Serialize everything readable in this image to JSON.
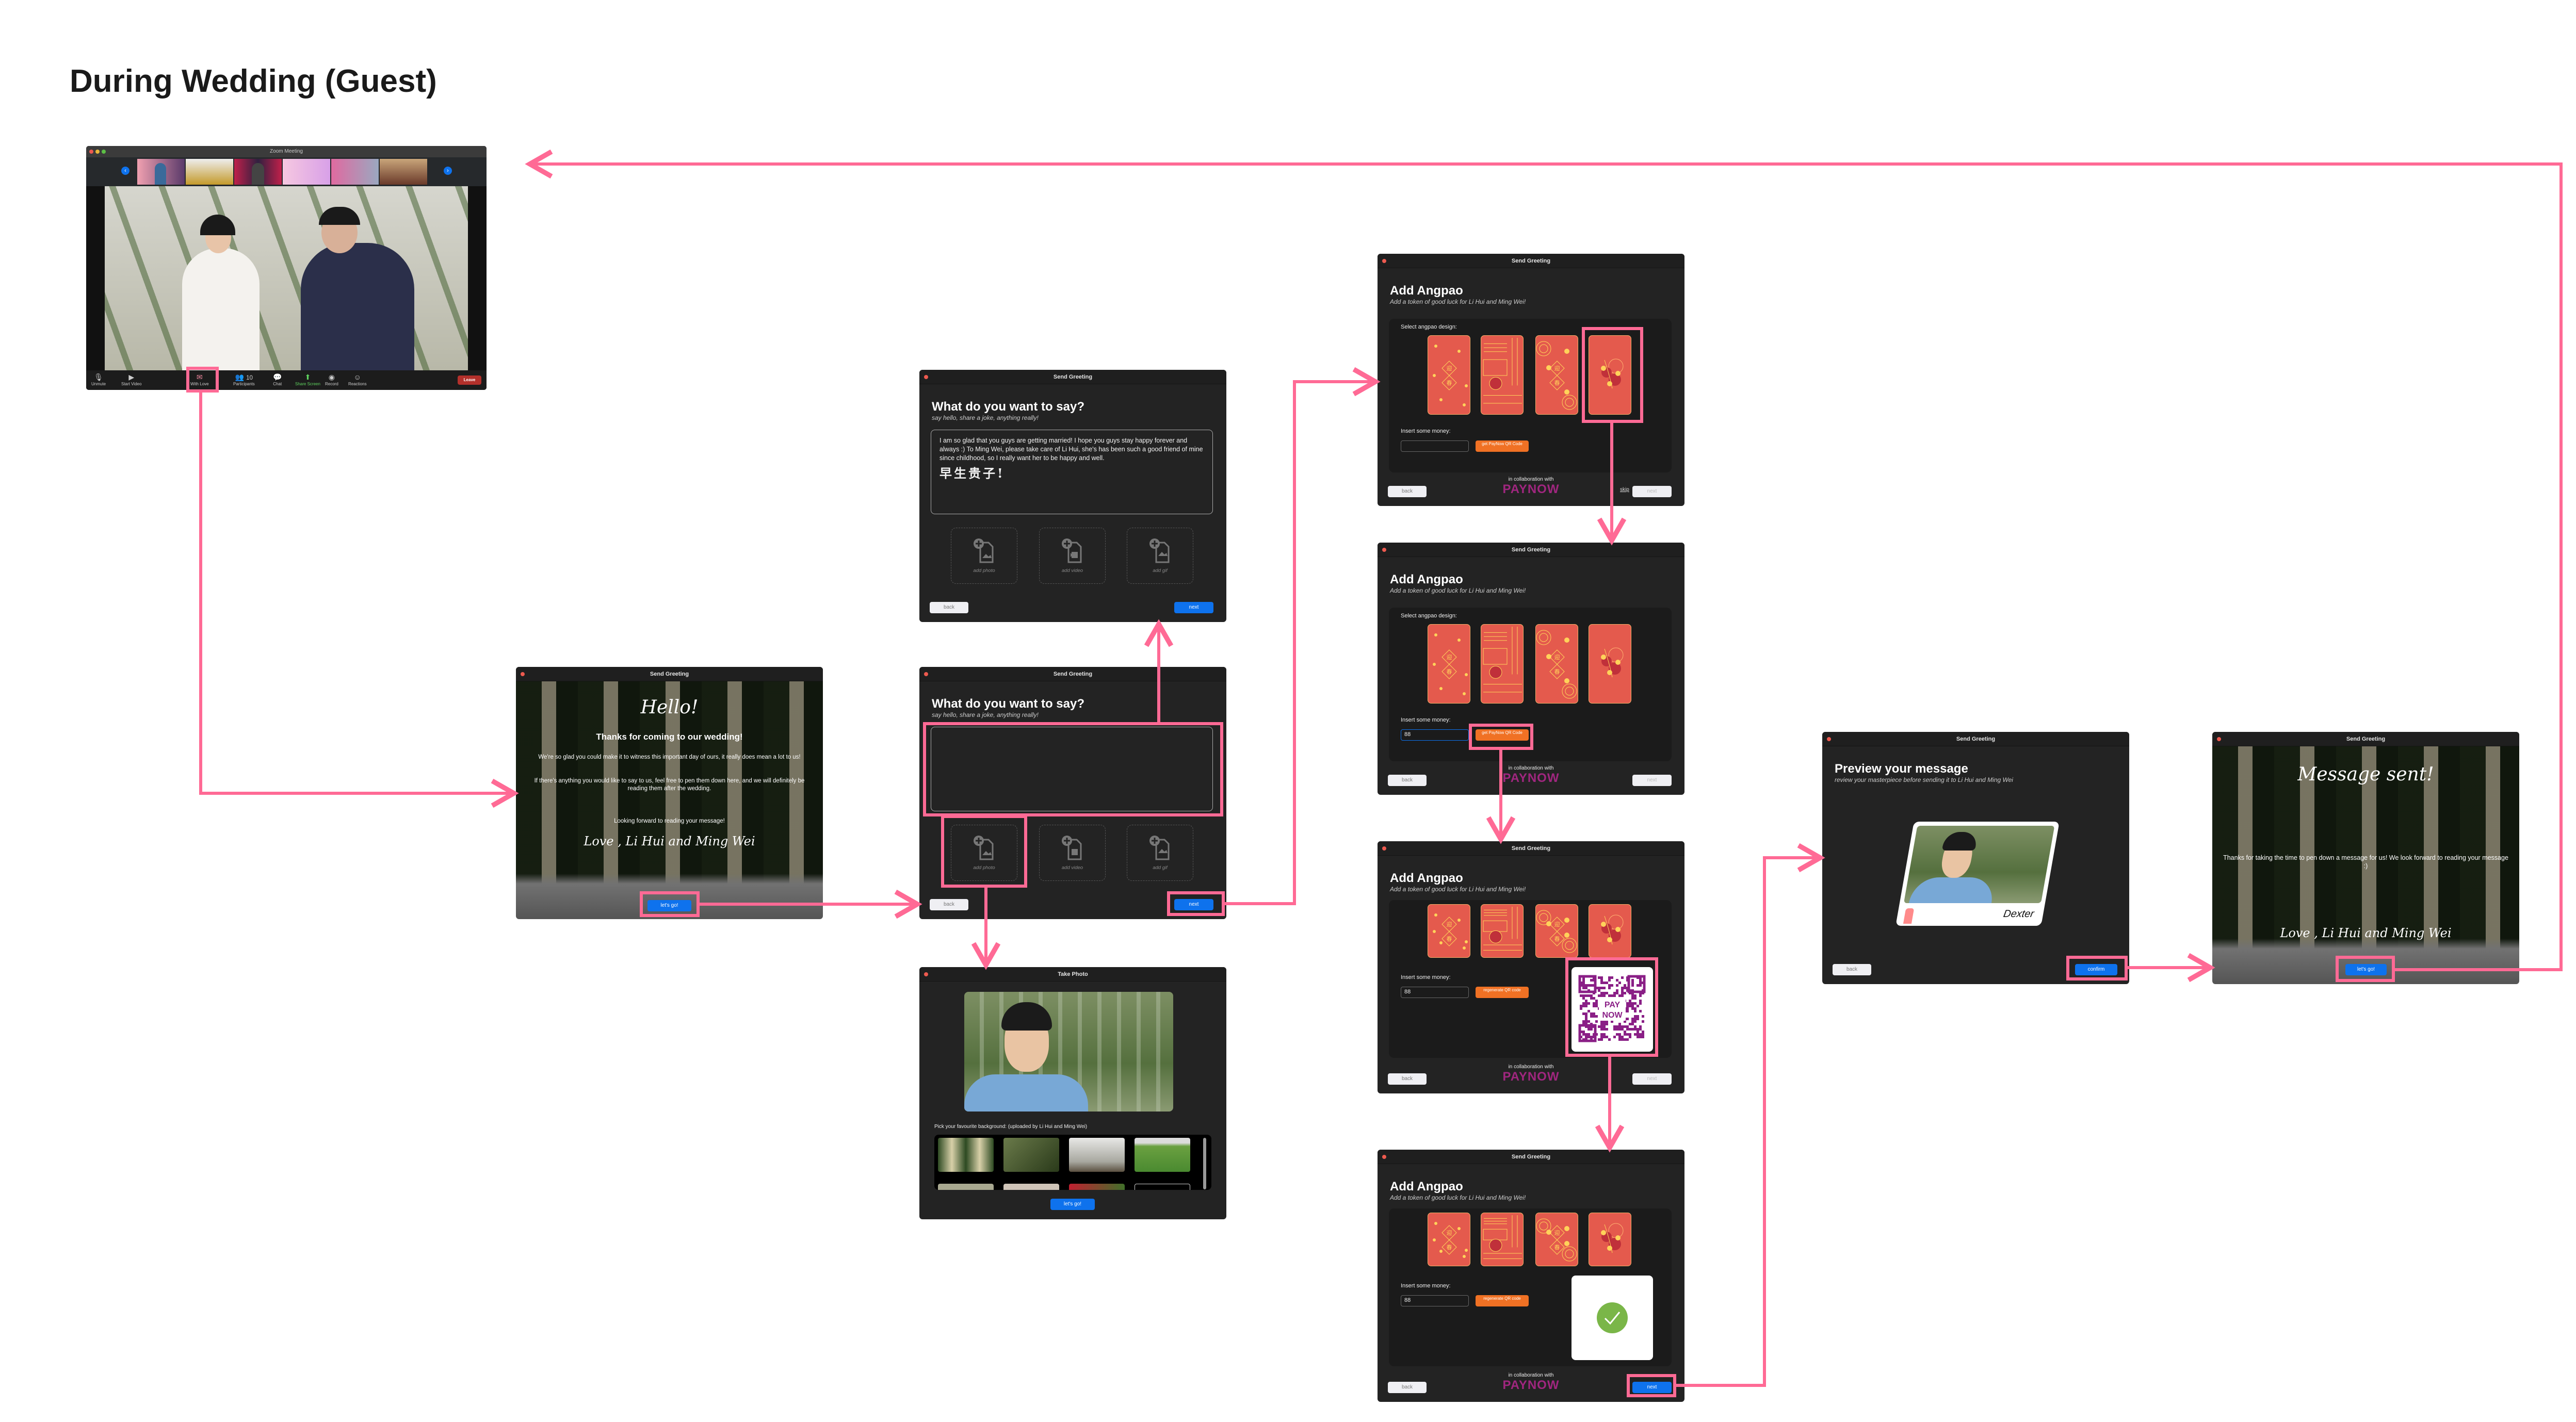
{
  "page_title": "During Wedding (Guest)",
  "colors": {
    "accent_pink": "#ff6a95",
    "button_blue": "#0e72ed",
    "paynow_purple": "#a0267f",
    "qr_orange": "#f07124",
    "angpao_red": "#e45a4d",
    "success_green": "#7ab648"
  },
  "zoom_meeting": {
    "title": "Zoom Meeting",
    "toolbar": [
      {
        "label": "Unmute",
        "icon": "mic-muted-icon"
      },
      {
        "label": "Start Video",
        "icon": "video-off-icon"
      },
      {
        "label": "With Love",
        "icon": "envelope-heart-icon"
      },
      {
        "label": "Participants",
        "icon": "participants-icon",
        "count": "10"
      },
      {
        "label": "Chat",
        "icon": "chat-icon"
      },
      {
        "label": "Share Screen",
        "icon": "share-screen-icon"
      },
      {
        "label": "Record",
        "icon": "record-icon"
      },
      {
        "label": "Reactions",
        "icon": "reactions-icon"
      }
    ],
    "leave": "Leave"
  },
  "common": {
    "window_title": "Send Greeting",
    "back": "back",
    "next": "next",
    "lets_go": "let's go!",
    "skip": "skip",
    "collab": "in collaboration with",
    "paynow": "PAYNOW"
  },
  "hello_screen": {
    "greeting": "Hello!",
    "headline": "Thanks for coming to our wedding!",
    "para1": "We're so glad you could make it to witness this important day of ours, it really does mean a lot to us!",
    "para2": "If there's anything you would like to say to us, feel free to pen them down here, and we will definitely be reading them after the wedding.",
    "para3": "Looking forward to reading your message!",
    "signoff": "Love , Li Hui and Ming Wei"
  },
  "say_screen": {
    "heading": "What do you want to say?",
    "subtitle": "say hello, share a joke, anything really!",
    "message": "I am so glad that you guys are getting married!  I hope you guys stay happy forever and always :) To Ming Wei, please take care of Li Hui, she's has been such a good friend of mine since childhood, so I really want her to be happy and well.",
    "chinese": "早生贵子!",
    "add_photo": "add photo",
    "add_video": "add video",
    "add_gif": "add gif"
  },
  "take_photo": {
    "title": "Take Photo",
    "label": "Pick your favourite background: (uploaded by Li Hui and Ming Wei)"
  },
  "angpao": {
    "heading": "Add Angpao",
    "subtitle": "Add a token of good luck for Li Hui and Ming Wei!",
    "select_label": "Select angpao design:",
    "money_label": "Insert some money:",
    "get_qr": "get PayNow QR Code",
    "regenerate": "regenerate QR code",
    "amount": "88",
    "card_chars": [
      "迎",
      "春"
    ],
    "qr_logo": [
      "PAY",
      "NOW"
    ]
  },
  "preview": {
    "heading": "Preview your message",
    "subtitle": "review your masterpiece before sending it to  Li Hui and Ming Wei",
    "name": "Dexter",
    "confirm": "confirm"
  },
  "sent": {
    "heading": "Message sent!",
    "body": "Thanks for taking the time to pen down a message for us! We look forward to reading your message :)",
    "signoff": "Love , Li Hui and Ming Wei"
  }
}
